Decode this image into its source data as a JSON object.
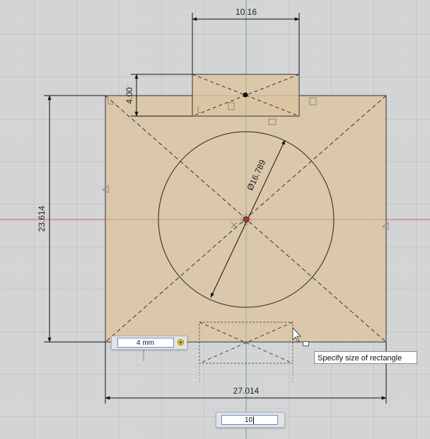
{
  "dimensions": {
    "top_width": "10.16",
    "small_height": "4.00",
    "total_height": "23.614",
    "circle_diameter": "Ø16.789",
    "bottom_width": "27.014"
  },
  "inputs": {
    "size_value": "4 mm",
    "size_lock": "lock-icon",
    "width_value": "10"
  },
  "tooltip": {
    "text": "Specify size of rectangle"
  },
  "colors": {
    "canvas_bg": "#d4d5d7",
    "profile_fill": "#dcc4a2",
    "x_axis": "#d86060",
    "y_axis": "#59b359"
  }
}
